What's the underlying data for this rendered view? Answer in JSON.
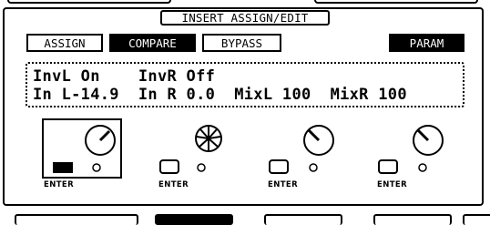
{
  "screen": {
    "title": "INSERT ASSIGN/EDIT"
  },
  "buttons": {
    "assign": "ASSIGN",
    "compare": "COMPARE",
    "bypass": "BYPASS",
    "param": "PARAM"
  },
  "display": {
    "line1": "InvL On    InvR Off",
    "line2": "In L-14.9  In R 0.0  MixL 100  MixR 100"
  },
  "parameters": [
    {
      "name": "InvL",
      "value": "On"
    },
    {
      "name": "InvR",
      "value": "Off"
    },
    {
      "name": "In L",
      "value": "-14.9"
    },
    {
      "name": "In R",
      "value": "0.0"
    },
    {
      "name": "MixL",
      "value": "100"
    },
    {
      "name": "MixR",
      "value": "100"
    }
  ],
  "knobs": [
    {
      "label": "ENTER",
      "selected": true,
      "style": "pointer",
      "angle": 60
    },
    {
      "label": "ENTER",
      "selected": false,
      "style": "sunburst",
      "angle": 0
    },
    {
      "label": "ENTER",
      "selected": false,
      "style": "pointer",
      "angle": 135
    },
    {
      "label": "ENTER",
      "selected": false,
      "style": "pointer",
      "angle": 135
    }
  ],
  "colors": {
    "foreground": "#000000",
    "background": "#ffffff"
  }
}
